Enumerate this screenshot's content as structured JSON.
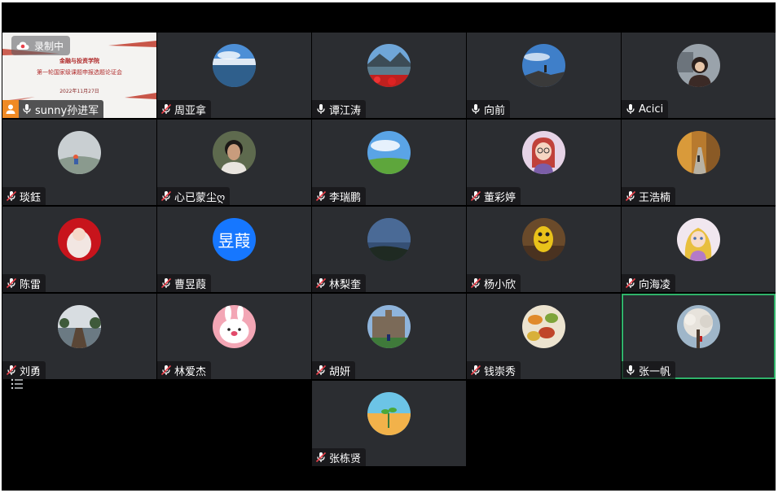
{
  "recording": {
    "label": "录制中"
  },
  "host": {
    "name": "sunny孙进军",
    "slide": {
      "line1": "金融与投资学院",
      "line2": "第一轮国家级课题申报选题论证会",
      "line3": "2022年11月27日"
    }
  },
  "participants": [
    {
      "name": "周亚拿",
      "muted": true,
      "avatar": "lake-sky"
    },
    {
      "name": "谭江涛",
      "muted": false,
      "avatar": "mountain-lake-red-flowers"
    },
    {
      "name": "向前",
      "muted": false,
      "avatar": "person-on-rocks-sky"
    },
    {
      "name": "Acici",
      "muted": false,
      "avatar": "woman-portrait"
    },
    {
      "name": "琰鈺",
      "muted": true,
      "avatar": "person-on-hill-fog"
    },
    {
      "name": "心已蒙尘ღ",
      "muted": true,
      "avatar": "young-man-portrait"
    },
    {
      "name": "李瑞鹏",
      "muted": true,
      "avatar": "green-field-blue-sky"
    },
    {
      "name": "董彩婷",
      "muted": true,
      "avatar": "cartoon-girl-glasses"
    },
    {
      "name": "王浩楠",
      "muted": true,
      "avatar": "autumn-road"
    },
    {
      "name": "陈雷",
      "muted": true,
      "avatar": "baby-red-blanket"
    },
    {
      "name": "曹昱葭",
      "muted": true,
      "avatar": "text",
      "avatar_text": "昱葭"
    },
    {
      "name": "林梨奎",
      "muted": true,
      "avatar": "dark-hill-sky"
    },
    {
      "name": "杨小欣",
      "muted": true,
      "avatar": "yellow-cartoon-figure"
    },
    {
      "name": "向海凌",
      "muted": true,
      "avatar": "cartoon-princess"
    },
    {
      "name": "刘勇",
      "muted": true,
      "avatar": "pier-lake"
    },
    {
      "name": "林爱杰",
      "muted": true,
      "avatar": "cony-rabbit"
    },
    {
      "name": "胡妍",
      "muted": true,
      "avatar": "university-building"
    },
    {
      "name": "钱崇秀",
      "muted": true,
      "avatar": "autumn-leaves"
    },
    {
      "name": "张一帆",
      "muted": false,
      "active": true,
      "avatar": "cherry-blossom-tree"
    },
    {
      "name": "张栋贤",
      "muted": true,
      "avatar": "sprout-sunset"
    }
  ],
  "colors": {
    "background": "#000000",
    "tile": "#2b2d31",
    "active_border": "#2fb36a",
    "text_avatar": "#1677ff",
    "host_badge": "#f08a24"
  }
}
